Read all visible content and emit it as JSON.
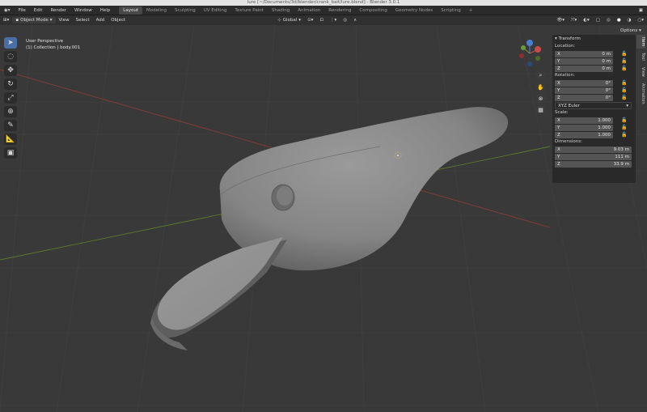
{
  "window": {
    "title": "lure [~/Documents/3d/blender/crank_bait/lure.blend] - Blender 3.0.1"
  },
  "topmenu": [
    "File",
    "Edit",
    "Render",
    "Window",
    "Help"
  ],
  "workspaces": [
    "Layout",
    "Modeling",
    "Sculpting",
    "UV Editing",
    "Texture Paint",
    "Shading",
    "Animation",
    "Rendering",
    "Compositing",
    "Geometry Nodes",
    "Scripting"
  ],
  "active_workspace": "Layout",
  "header": {
    "mode": "Object Mode",
    "menus": [
      "View",
      "Select",
      "Add",
      "Object"
    ],
    "orientation": "Global",
    "options": "Options"
  },
  "viewport": {
    "perspective": "User Perspective",
    "collection": "(1) Collection | body.001"
  },
  "npanel": {
    "section": "Transform",
    "location_label": "Location:",
    "location": [
      {
        "axis": "X",
        "value": "0 m"
      },
      {
        "axis": "Y",
        "value": "0 m"
      },
      {
        "axis": "Z",
        "value": "0 m"
      }
    ],
    "rotation_label": "Rotation:",
    "rotation": [
      {
        "axis": "X",
        "value": "0°"
      },
      {
        "axis": "Y",
        "value": "0°"
      },
      {
        "axis": "Z",
        "value": "0°"
      }
    ],
    "rotation_mode": "XYZ Euler",
    "scale_label": "Scale:",
    "scale": [
      {
        "axis": "X",
        "value": "1.000"
      },
      {
        "axis": "Y",
        "value": "1.000"
      },
      {
        "axis": "Z",
        "value": "1.000"
      }
    ],
    "dimensions_label": "Dimensions:",
    "dimensions": [
      {
        "axis": "X",
        "value": "9.03 m"
      },
      {
        "axis": "Y",
        "value": "111 m"
      },
      {
        "axis": "Z",
        "value": "33.9 m"
      }
    ]
  },
  "side_tabs": [
    "Item",
    "Tool",
    "View",
    "Animation"
  ],
  "colors": {
    "accent": "#4a6fa5",
    "grid": "#3a3a3a",
    "x_axis": "#8a3a3a",
    "y_axis": "#5d7a2a",
    "mesh": "#8a8a8a"
  }
}
